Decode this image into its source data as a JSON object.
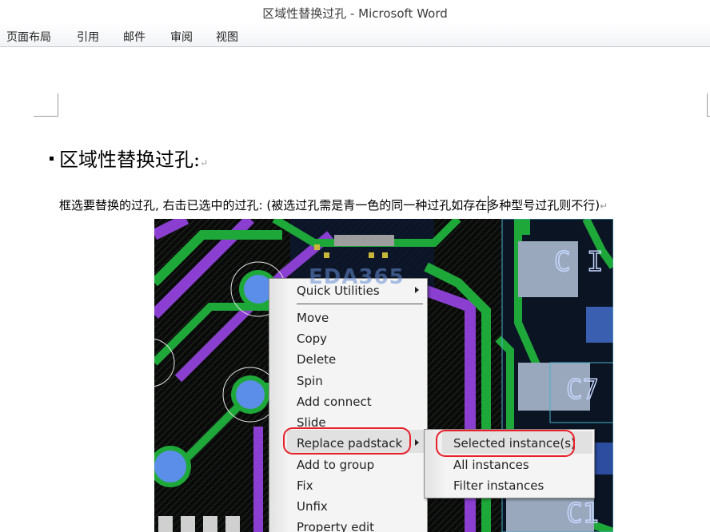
{
  "window": {
    "title": "区域性替换过孔 - Microsoft Word"
  },
  "ribbon": {
    "tabs": [
      "页面布局",
      "引用",
      "邮件",
      "审阅",
      "视图"
    ]
  },
  "document": {
    "heading": "区域性替换过孔:",
    "paragraph_mark": "↵",
    "paragraph": "框选要替换的过孔, 右击已选中的过孔: (被选过孔需是青一色的同一种过孔如存在多种型号过孔则不行)"
  },
  "screenshot": {
    "watermark": "EDA365",
    "context_menu": {
      "items": [
        "Quick Utilities",
        "Move",
        "Copy",
        "Delete",
        "Spin",
        "Add connect",
        "Slide",
        "Replace padstack",
        "Add to group",
        "Fix",
        "Unfix",
        "Property edit"
      ],
      "highlighted": "Replace padstack"
    },
    "submenu": {
      "items": [
        "Selected instance(s)",
        "All instances",
        "Filter instances"
      ],
      "highlighted": "Selected instance(s)"
    },
    "pcb_labels": {
      "c7": "C7",
      "c1": "C1",
      "top_right": "C I"
    },
    "colors": {
      "board_bg": "#0a0a0a",
      "trace_green": "#1fa83a",
      "trace_purple": "#8a3fd0",
      "pad_blue": "#5b8ee8",
      "annotation_red": "#e8202a"
    }
  }
}
